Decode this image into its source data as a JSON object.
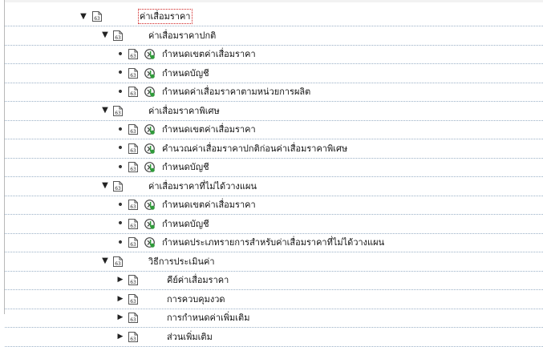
{
  "tree": {
    "nodes": [
      {
        "text": "ค่าเสื่อมราคา",
        "level": 0,
        "toggle": "expanded",
        "exec_icon": false,
        "selected": true
      },
      {
        "text": "ค่าเสื่อมราคาปกติ",
        "level": 1,
        "toggle": "expanded",
        "exec_icon": false,
        "selected": false
      },
      {
        "text": "กำหนดเขตค่าเสื่อมราคา",
        "level": 2,
        "toggle": "bullet",
        "exec_icon": true,
        "selected": false
      },
      {
        "text": "กำหนดบัญชี",
        "level": 2,
        "toggle": "bullet",
        "exec_icon": true,
        "selected": false
      },
      {
        "text": "กำหนดค่าเสื่อมราคาตามหน่วยการผลิต",
        "level": 2,
        "toggle": "bullet",
        "exec_icon": true,
        "selected": false
      },
      {
        "text": "ค่าเสื่อมราคาพิเศษ",
        "level": 1,
        "toggle": "expanded",
        "exec_icon": false,
        "selected": false
      },
      {
        "text": "กำหนดเขตค่าเสื่อมราคา",
        "level": 2,
        "toggle": "bullet",
        "exec_icon": true,
        "selected": false
      },
      {
        "text": "คำนวณค่าเสื่อมราคาปกติก่อนค่าเสื่อมราคาพิเศษ",
        "level": 2,
        "toggle": "bullet",
        "exec_icon": true,
        "selected": false
      },
      {
        "text": "กำหนดบัญชี",
        "level": 2,
        "toggle": "bullet",
        "exec_icon": true,
        "selected": false
      },
      {
        "text": "ค่าเสื่อมราคาที่ไม่ได้วางแผน",
        "level": 1,
        "toggle": "expanded",
        "exec_icon": false,
        "selected": false
      },
      {
        "text": "กำหนดเขตค่าเสื่อมราคา",
        "level": 2,
        "toggle": "bullet",
        "exec_icon": true,
        "selected": false
      },
      {
        "text": "กำหนดบัญชี",
        "level": 2,
        "toggle": "bullet",
        "exec_icon": true,
        "selected": false
      },
      {
        "text": "กำหนดประเภทรายการสำหรับค่าเสื่อมราคาที่ไม่ได้วางแผน",
        "level": 2,
        "toggle": "bullet",
        "exec_icon": true,
        "selected": false
      },
      {
        "text": "วิธีการประเมินค่า",
        "level": 1,
        "toggle": "expanded",
        "exec_icon": false,
        "selected": false
      },
      {
        "text": "คีย์ค่าเสื่อมราคา",
        "level": 2,
        "toggle": "collapsed",
        "exec_icon": false,
        "selected": false
      },
      {
        "text": "การควบคุมงวด",
        "level": 2,
        "toggle": "collapsed",
        "exec_icon": false,
        "selected": false
      },
      {
        "text": "การกำหนดค่าเพิ่มเติม",
        "level": 2,
        "toggle": "collapsed",
        "exec_icon": false,
        "selected": false
      },
      {
        "text": "ส่วนเพิ่มเติม",
        "level": 2,
        "toggle": "collapsed",
        "exec_icon": false,
        "selected": false
      }
    ]
  },
  "icons": {
    "folder": "document-folder-icon",
    "exec": "execute-activity-icon",
    "expanded": "triangle-down-icon",
    "collapsed": "triangle-right-icon",
    "bullet": "bullet-icon"
  },
  "colors": {
    "selection_outline": "#d02020",
    "separator": "#9ab0c6",
    "exec_green": "#2f9a3a"
  }
}
